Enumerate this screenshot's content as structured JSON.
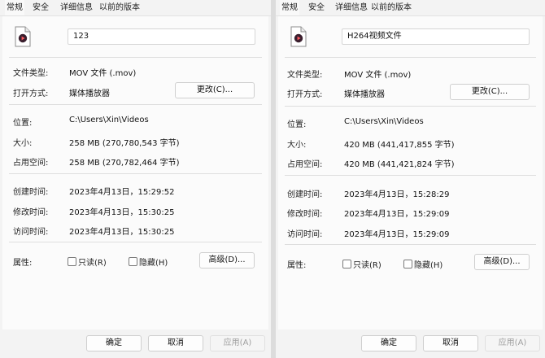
{
  "left": {
    "tabs": [
      "常规",
      "安全",
      "详细信息",
      "以前的版本"
    ],
    "file_name": "123",
    "file_type_label": "文件类型:",
    "file_type_value": "MOV 文件 (.mov)",
    "open_with_label": "打开方式:",
    "open_with_value": "媒体播放器",
    "change_button": "更改(C)...",
    "location_label": "位置:",
    "location_value": "C:\\Users\\Xin\\Videos",
    "size_label": "大小:",
    "size_value": "258 MB (270,780,543 字节)",
    "size_on_disk_label": "占用空间:",
    "size_on_disk_value": "258 MB (270,782,464 字节)",
    "created_label": "创建时间:",
    "created_value": "2023年4月13日，15:29:52",
    "modified_label": "修改时间:",
    "modified_value": "2023年4月13日，15:30:25",
    "accessed_label": "访问时间:",
    "accessed_value": "2023年4月13日，15:30:25",
    "attributes_label": "属性:",
    "readonly_label": "只读(R)",
    "hidden_label": "隐藏(H)",
    "advanced_button": "高级(D)...",
    "ok_button": "确定",
    "cancel_button": "取消",
    "apply_button": "应用(A)"
  },
  "right": {
    "tabs": [
      "常规",
      "安全",
      "详细信息",
      "以前的版本"
    ],
    "file_name": "H264视频文件",
    "file_type_label": "文件类型:",
    "file_type_value": "MOV 文件 (.mov)",
    "open_with_label": "打开方式:",
    "open_with_value": "媒体播放器",
    "change_button": "更改(C)...",
    "location_label": "位置:",
    "location_value": "C:\\Users\\Xin\\Videos",
    "size_label": "大小:",
    "size_value": "420 MB (441,417,855 字节)",
    "size_on_disk_label": "占用空间:",
    "size_on_disk_value": "420 MB (441,421,824 字节)",
    "created_label": "创建时间:",
    "created_value": "2023年4月13日，15:28:29",
    "modified_label": "修改时间:",
    "modified_value": "2023年4月13日，15:29:09",
    "accessed_label": "访问时间:",
    "accessed_value": "2023年4月13日，15:29:09",
    "attributes_label": "属性:",
    "readonly_label": "只读(R)",
    "hidden_label": "隐藏(H)",
    "advanced_button": "高级(D)...",
    "ok_button": "确定",
    "cancel_button": "取消",
    "apply_button": "应用(A)"
  }
}
